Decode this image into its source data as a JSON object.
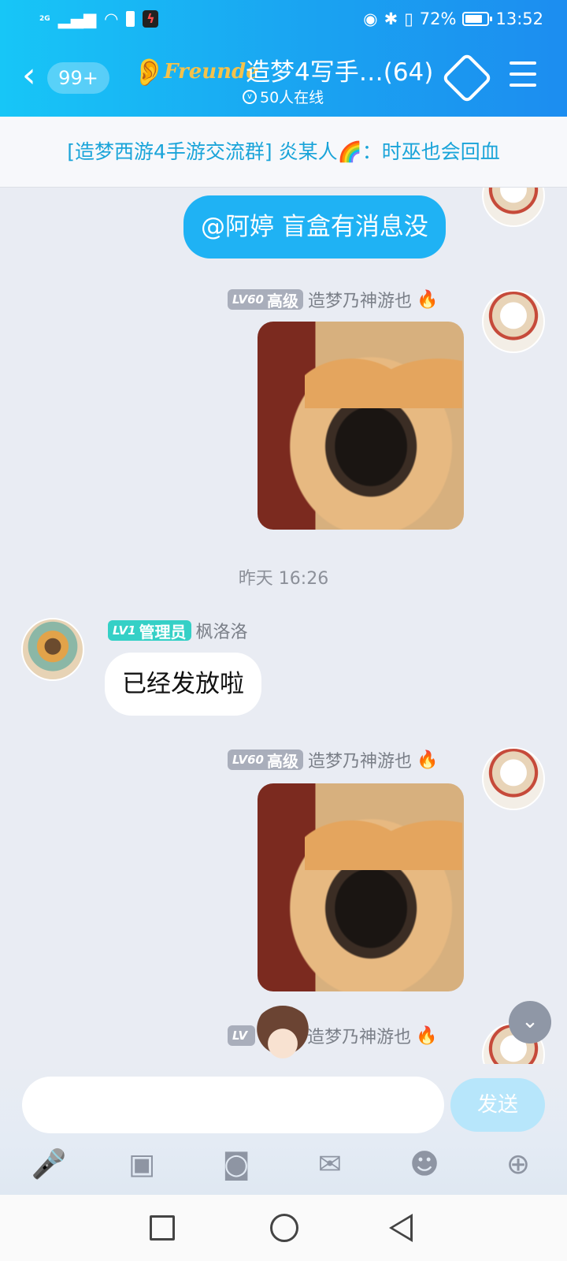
{
  "status": {
    "network": "2G",
    "battery": "72%",
    "time": "13:52"
  },
  "header": {
    "back_badge": "99+",
    "brand": "Freunde",
    "title": "造梦4写手…(64)",
    "online": "50人在线"
  },
  "announcement": "[造梦西游4手游交流群] 炎某人🌈：时巫也会回血",
  "messages": {
    "m1": {
      "text": "@阿婷 盲盒有消息没"
    },
    "m2": {
      "level": "LV60",
      "role": "高级",
      "name": "造梦乃神游也"
    },
    "timestamp": "昨天 16:26",
    "m3": {
      "level": "LV1",
      "role": "管理员",
      "name": "枫洛洛",
      "text": "已经发放啦"
    },
    "m4": {
      "level": "LV60",
      "role": "高级",
      "name": "造梦乃神游也"
    },
    "m5": {
      "level": "LV",
      "name": "造梦乃神游也"
    }
  },
  "input": {
    "placeholder": "",
    "send": "发送"
  },
  "icons": {
    "back": "chevron-left-icon",
    "ear": "ear-icon",
    "tag": "tag-icon",
    "menu": "menu-icon",
    "mic": "microphone-icon",
    "image": "image-icon",
    "camera": "camera-icon",
    "redpacket": "red-packet-icon",
    "emoji": "emoji-icon",
    "plus": "plus-icon"
  },
  "colors": {
    "header": "#1aa3f1",
    "my_bubble": "#1fb2f4",
    "send_disabled": "#b7e6fb",
    "admin_badge": "#35d0c6"
  }
}
